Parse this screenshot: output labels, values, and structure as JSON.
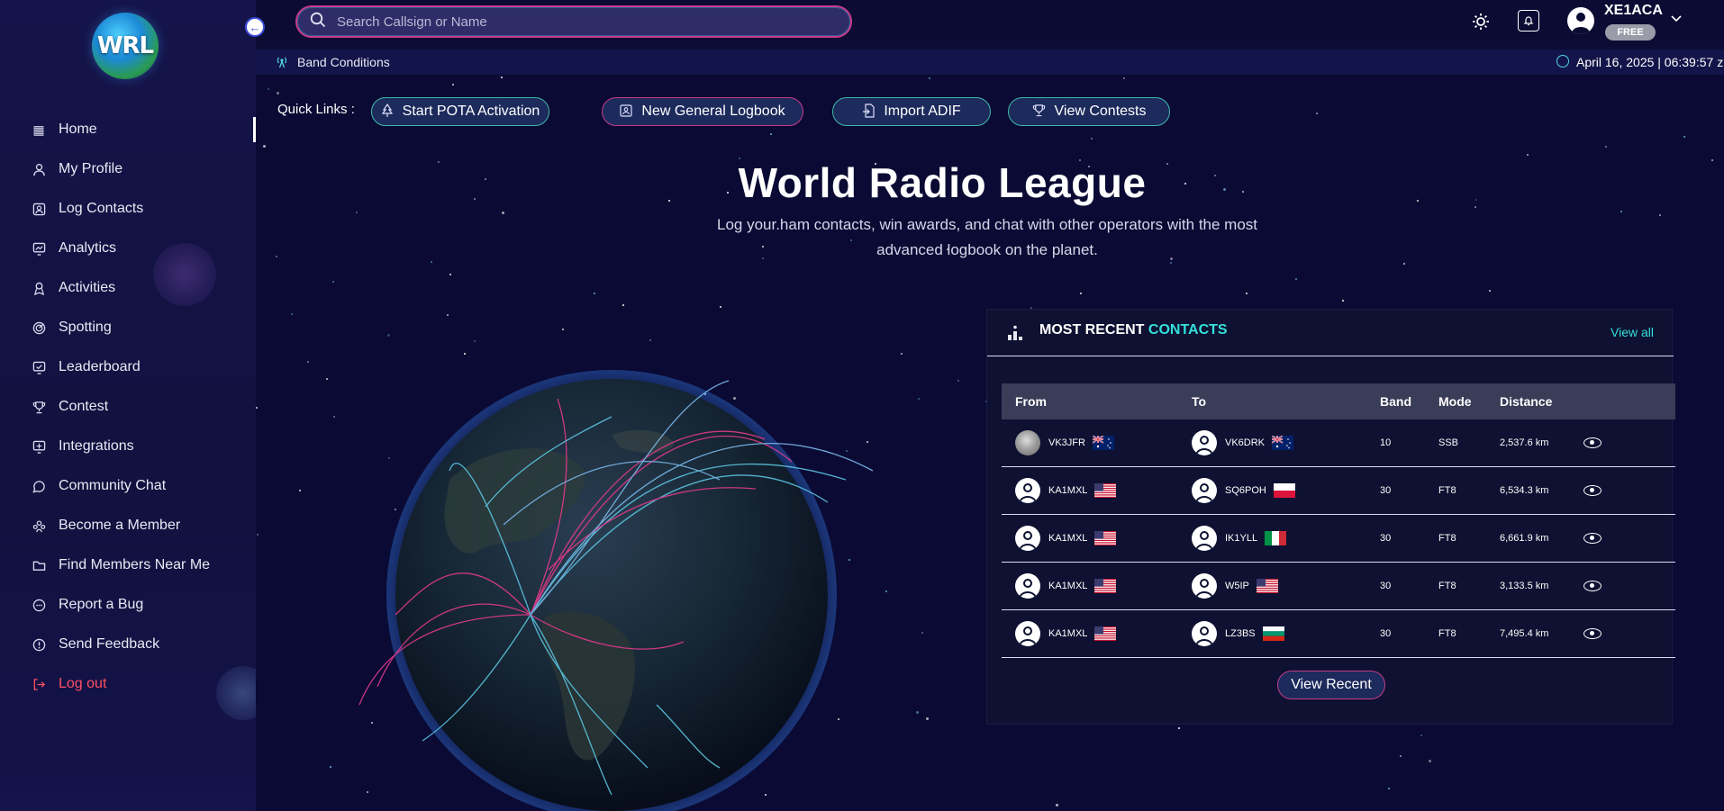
{
  "app": {
    "logo_text": "WRL"
  },
  "sidebar": {
    "items": [
      {
        "label": "Home",
        "icon": "grid-icon"
      },
      {
        "label": "My Profile",
        "icon": "user-icon"
      },
      {
        "label": "Log Contacts",
        "icon": "contact-card-icon"
      },
      {
        "label": "Analytics",
        "icon": "chart-icon"
      },
      {
        "label": "Activities",
        "icon": "activity-icon"
      },
      {
        "label": "Spotting",
        "icon": "radar-icon"
      },
      {
        "label": "Leaderboard",
        "icon": "leaderboard-icon"
      },
      {
        "label": "Contest",
        "icon": "trophy-icon"
      },
      {
        "label": "Integrations",
        "icon": "integrations-icon"
      },
      {
        "label": "Community Chat",
        "icon": "chat-icon"
      },
      {
        "label": "Become a Member",
        "icon": "members-icon"
      },
      {
        "label": "Find Members Near Me",
        "icon": "folder-icon"
      },
      {
        "label": "Report a Bug",
        "icon": "bug-icon"
      },
      {
        "label": "Send Feedback",
        "icon": "feedback-icon"
      },
      {
        "label": "Log out",
        "icon": "logout-icon"
      }
    ]
  },
  "header": {
    "search_placeholder": "Search Callsign or Name",
    "username": "XE1ACA",
    "plan_badge": "FREE"
  },
  "band_bar": {
    "label": "Band Conditions",
    "datetime": "April 16, 2025 | 06:39:57 z"
  },
  "quick_links": {
    "label": "Quick Links :",
    "buttons": [
      {
        "label": "Start POTA Activation",
        "icon": "tree-icon"
      },
      {
        "label": "New General Logbook",
        "icon": "logbook-icon"
      },
      {
        "label": "Import ADIF",
        "icon": "import-icon"
      },
      {
        "label": "View Contests",
        "icon": "trophy-icon"
      }
    ]
  },
  "hero": {
    "title": "World Radio League",
    "subtitle": "Log your.ham contacts, win awards, and chat with other operators with the most advanced logbook on the planet."
  },
  "recent_contacts": {
    "title_main": "MOST RECENT",
    "title_accent": "CONTACTS",
    "view_all": "View all",
    "columns": [
      "From",
      "To",
      "Band",
      "Mode",
      "Distance"
    ],
    "rows": [
      {
        "from": "VK3JFR",
        "from_flag": "AU",
        "to": "VK6DRK",
        "to_flag": "AU",
        "band": "10",
        "mode": "SSB",
        "distance": "2,537.6 km"
      },
      {
        "from": "KA1MXL",
        "from_flag": "US",
        "to": "SQ6POH",
        "to_flag": "PL",
        "band": "30",
        "mode": "FT8",
        "distance": "6,534.3 km"
      },
      {
        "from": "KA1MXL",
        "from_flag": "US",
        "to": "IK1YLL",
        "to_flag": "IT",
        "band": "30",
        "mode": "FT8",
        "distance": "6,661.9 km"
      },
      {
        "from": "KA1MXL",
        "from_flag": "US",
        "to": "W5IP",
        "to_flag": "US",
        "band": "30",
        "mode": "FT8",
        "distance": "3,133.5 km"
      },
      {
        "from": "KA1MXL",
        "from_flag": "US",
        "to": "LZ3BS",
        "to_flag": "BG",
        "band": "30",
        "mode": "FT8",
        "distance": "7,495.4 km"
      }
    ],
    "view_recent": "View Recent"
  },
  "colors": {
    "accent_teal": "#33e0dc",
    "accent_pink": "#c73a8c",
    "logout_red": "#ff4f63",
    "background": "#0a0a34"
  }
}
